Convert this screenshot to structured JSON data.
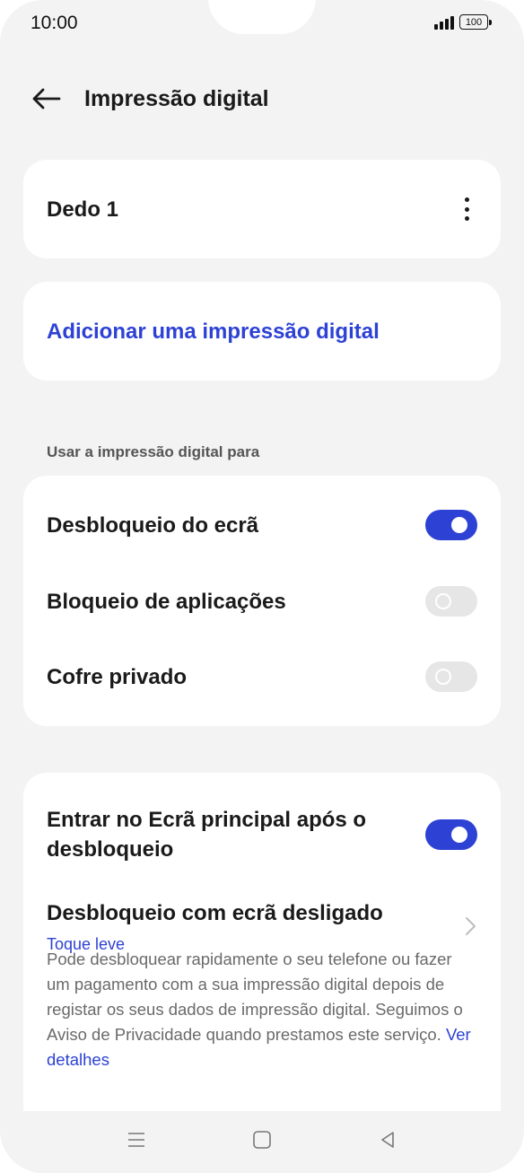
{
  "status_bar": {
    "time": "10:00",
    "battery": "100"
  },
  "header": {
    "title": "Impressão digital"
  },
  "fingerprint_card": {
    "label": "Dedo 1"
  },
  "add_card": {
    "label": "Adicionar uma impressão digital"
  },
  "use_section": {
    "label": "Usar a impressão digital para",
    "items": [
      {
        "label": "Desbloqueio do ecrã",
        "enabled": true
      },
      {
        "label": "Bloqueio de aplicações",
        "enabled": false
      },
      {
        "label": "Cofre privado",
        "enabled": false
      }
    ]
  },
  "more_card": {
    "home_after_unlock": {
      "line1": "Entrar no Ecrã principal após o",
      "line2": "desbloqueio",
      "enabled": true
    },
    "screen_off_unlock": {
      "label": "Desbloqueio com ecrã desligado",
      "value": "Toque leve"
    },
    "description": "Pode desbloquear rapidamente o seu telefone ou fazer um pagamento com a sua impressão digital depois de registar os seus dados de impressão digital. Seguimos o Aviso de Privacidade quando prestamos este serviço.",
    "details_link": "Ver detalhes"
  },
  "colors": {
    "accent": "#2d42d4",
    "background": "#f3f3f3",
    "card": "#ffffff"
  }
}
